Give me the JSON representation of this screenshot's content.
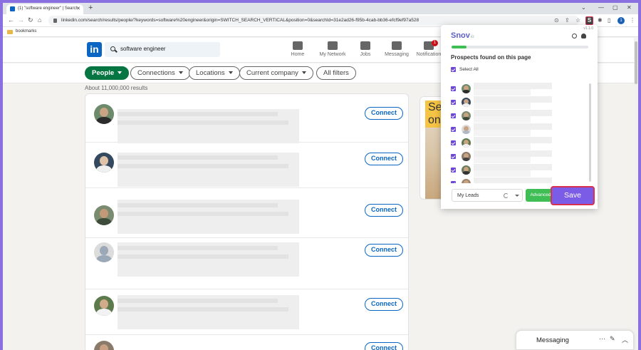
{
  "browser": {
    "tab_title": "(1) \"software engineer\" | Search",
    "new_tab": "+",
    "url": "linkedin.com/search/results/people/?keywords=software%20engineer&origin=SWITCH_SEARCH_VERTICAL&position=0&searchId=31e2ad26-f95b-4cab-bb36-efcf9ef97a528",
    "profile_initial": "1",
    "bookmarks_label": "bookmarks"
  },
  "linkedin": {
    "logo": "in",
    "search_value": "software engineer",
    "nav": [
      {
        "label": "Home",
        "icon": "home-icon"
      },
      {
        "label": "My Network",
        "icon": "network-icon"
      },
      {
        "label": "Jobs",
        "icon": "briefcase-icon"
      },
      {
        "label": "Messaging",
        "icon": "chat-icon"
      },
      {
        "label": "Notification",
        "icon": "bell-icon",
        "badge": "1"
      }
    ],
    "filters": [
      {
        "label": "People",
        "active": true
      },
      {
        "label": "Connections"
      },
      {
        "label": "Locations"
      },
      {
        "label": "Current company"
      },
      {
        "label": "All filters"
      }
    ],
    "results_count": "About 11,000,000 results",
    "connect_label": "Connect",
    "ad_text": "Se on",
    "messaging_label": "Messaging"
  },
  "snov": {
    "logo": "Snov",
    "logo_suffix": "io",
    "version": "v1.1.0",
    "progress_fraction": 0.11,
    "heading": "Prospects found on this page",
    "select_all": "Select All",
    "list_value": "My Leads",
    "advanced_label": "Advanced",
    "save_label": "Save"
  },
  "colors": {
    "linkedin_blue": "#0a66c2",
    "people_green": "#057642",
    "snov_purple": "#7b5ce6",
    "advanced_green": "#3fbe56",
    "highlight_red": "#d9304f"
  }
}
